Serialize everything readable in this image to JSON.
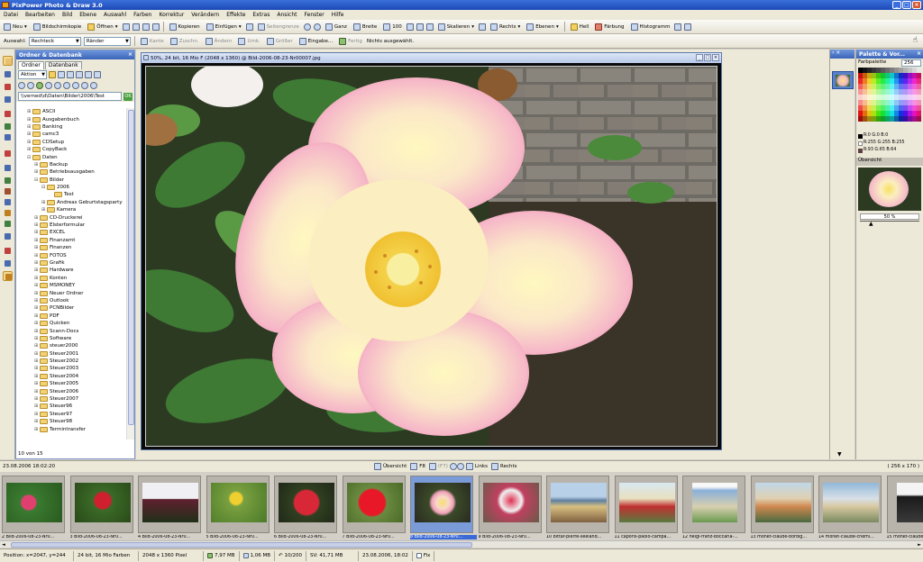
{
  "app": {
    "title": "PixPower Photo & Draw 3.0"
  },
  "menu": [
    "Datei",
    "Bearbeiten",
    "Bild",
    "Ebene",
    "Auswahl",
    "Farben",
    "Korrektur",
    "Verändern",
    "Effekte",
    "Extras",
    "Ansicht",
    "Fenster",
    "Hilfe"
  ],
  "toolbar1": {
    "neu": "Neu",
    "bildschirmkopie": "Bildschirmkopie",
    "oeffnen": "Öffnen",
    "kopieren": "Kopieren",
    "einfuegen": "Einfügen",
    "seitengrenze": "Seitengrenze",
    "ganz": "Ganz",
    "breite": "Breite",
    "zoom": "100",
    "skalieren": "Skalieren",
    "rechts": "Rechts",
    "ebenen": "Ebenen",
    "hell": "Hell",
    "faerbung": "Färbung",
    "histogramm": "Histogramm"
  },
  "toolbar2": {
    "auswahl_label": "Auswahl:",
    "auswahl_value": "Rechteck",
    "raender": "Ränder",
    "kante": "Kante",
    "zuschn": "Zuschn.",
    "aendern": "Ändern",
    "umk": "Umk.",
    "groesser": "Größer",
    "eingabe": "Eingabe...",
    "fertig": "Fertig",
    "status": "Nichts ausgewählt."
  },
  "folder_panel": {
    "title": "Ordner & Datenbank",
    "tabs": [
      "Ordner",
      "Datenbank"
    ],
    "aktion": "Aktion",
    "path": "\\\\verned\\d\\Daten\\Bilder\\2006\\Test",
    "ok": "OK",
    "count": "10 von 15",
    "tree": [
      {
        "label": "ASCII",
        "level": 0,
        "exp": "+"
      },
      {
        "label": "Ausgabenbuch",
        "level": 0,
        "exp": "+"
      },
      {
        "label": "Banking",
        "level": 0,
        "exp": "+"
      },
      {
        "label": "camc3",
        "level": 0,
        "exp": "+"
      },
      {
        "label": "CDSetup",
        "level": 0,
        "exp": "+"
      },
      {
        "label": "CopyBack",
        "level": 0,
        "exp": "+"
      },
      {
        "label": "Daten",
        "level": 0,
        "exp": "-"
      },
      {
        "label": "Backup",
        "level": 1,
        "exp": "+"
      },
      {
        "label": "Betriebsausgaben",
        "level": 1,
        "exp": "+"
      },
      {
        "label": "Bilder",
        "level": 1,
        "exp": "-"
      },
      {
        "label": "2006",
        "level": 2,
        "exp": "-"
      },
      {
        "label": "Test",
        "level": 3,
        "exp": ""
      },
      {
        "label": "Andreas Geburtstagsparty",
        "level": 2,
        "exp": "+"
      },
      {
        "label": "Kamera",
        "level": 2,
        "exp": "+"
      },
      {
        "label": "CD-Druckerei",
        "level": 1,
        "exp": "+"
      },
      {
        "label": "Elsterformular",
        "level": 1,
        "exp": "+"
      },
      {
        "label": "EXCEL",
        "level": 1,
        "exp": "+"
      },
      {
        "label": "Finanzamt",
        "level": 1,
        "exp": "+"
      },
      {
        "label": "Finanzen",
        "level": 1,
        "exp": "+"
      },
      {
        "label": "FOTOS",
        "level": 1,
        "exp": "+"
      },
      {
        "label": "Grafik",
        "level": 1,
        "exp": "+"
      },
      {
        "label": "Hardware",
        "level": 1,
        "exp": "+"
      },
      {
        "label": "Konten",
        "level": 1,
        "exp": "+"
      },
      {
        "label": "MSMONEY",
        "level": 1,
        "exp": "+"
      },
      {
        "label": "Neuer Ordner",
        "level": 1,
        "exp": "+"
      },
      {
        "label": "Outlook",
        "level": 1,
        "exp": "+"
      },
      {
        "label": "PCNBilder",
        "level": 1,
        "exp": "+"
      },
      {
        "label": "PDF",
        "level": 1,
        "exp": "+"
      },
      {
        "label": "Quicken",
        "level": 1,
        "exp": "+"
      },
      {
        "label": "Scann-Docs",
        "level": 1,
        "exp": "+"
      },
      {
        "label": "Software",
        "level": 1,
        "exp": "+"
      },
      {
        "label": "steuer2000",
        "level": 1,
        "exp": "+"
      },
      {
        "label": "Steuer2001",
        "level": 1,
        "exp": "+"
      },
      {
        "label": "Steuer2002",
        "level": 1,
        "exp": "+"
      },
      {
        "label": "Steuer2003",
        "level": 1,
        "exp": "+"
      },
      {
        "label": "Steuer2004",
        "level": 1,
        "exp": "+"
      },
      {
        "label": "Steuer2005",
        "level": 1,
        "exp": "+"
      },
      {
        "label": "Steuer2006",
        "level": 1,
        "exp": "+"
      },
      {
        "label": "Steuer2007",
        "level": 1,
        "exp": "+"
      },
      {
        "label": "Steuer96",
        "level": 1,
        "exp": "+"
      },
      {
        "label": "Steuer97",
        "level": 1,
        "exp": "+"
      },
      {
        "label": "Steuer98",
        "level": 1,
        "exp": "+"
      },
      {
        "label": "Termintransfer",
        "level": 1,
        "exp": "+"
      }
    ]
  },
  "image_window": {
    "title": "50%, 24 bit, 16 Mio F (2048 x 1360) @ Bild-2006-08-23-Nr00007.jpg"
  },
  "right_panel": {
    "title": "Palette & Vor...",
    "farbpalette": "Farbpalette",
    "palette_count": "256",
    "rgb": [
      "R:0   G:0   B:0",
      "R:255 G:255 B:255",
      "R:93  G:65  B:64"
    ],
    "uebersicht": "Übersicht",
    "zoom": "50 %"
  },
  "browser_bar": {
    "date": "23.08.2006 18:02:20",
    "uebersicht": "Übersicht",
    "f8": "F8",
    "f7": "(F7)",
    "links": "Links",
    "rechts": "Rechts",
    "count": "( 256 x 170 )"
  },
  "thumbnails": [
    {
      "num": "2",
      "label": "Bild-2006-08-23-Nr0...",
      "selected": false
    },
    {
      "num": "3",
      "label": "Bild-2006-08-23-Nr0...",
      "selected": false
    },
    {
      "num": "4",
      "label": "Bild-2006-08-23-Nr0...",
      "selected": false
    },
    {
      "num": "5",
      "label": "Bild-2006-08-23-Nr0...",
      "selected": false
    },
    {
      "num": "6",
      "label": "Bild-2006-08-23-Nr0...",
      "selected": false
    },
    {
      "num": "7",
      "label": "Bild-2006-08-23-Nr0...",
      "selected": false
    },
    {
      "num": "8",
      "label": "Bild-2006-08-23-Nr0...",
      "selected": true
    },
    {
      "num": "9",
      "label": "Bild-2006-08-23-Nr0...",
      "selected": false
    },
    {
      "num": "10",
      "label": "bittar-pierre-seeland...",
      "selected": false
    },
    {
      "num": "11",
      "label": "caporis-paolo-campa...",
      "selected": false
    },
    {
      "num": "12",
      "label": "helgi-franz-boccaria-...",
      "selected": false
    },
    {
      "num": "13",
      "label": "monet-claude-bordig...",
      "selected": false
    },
    {
      "num": "14",
      "label": "monet-claude-chemi...",
      "selected": false
    },
    {
      "num": "15",
      "label": "monet-claude-...",
      "selected": false
    }
  ],
  "statusbar": {
    "position": "Position: x=2047, y=244",
    "colors": "24 bit, 16 Mio Farben",
    "size": "2048 x 1360 Pixel",
    "mem1": "7,97 MB",
    "mem2": "1,06 MB",
    "undo": "10/200",
    "sv": "SV:  41,71 MB",
    "datetime": "23.08.2006, 18:02",
    "fix": "Fix"
  },
  "colors": {
    "titlebar": "#1c4ab8",
    "panel_header": "#3a64b8",
    "selected_thumb": "#3a6ad8",
    "folder": "#f3d274"
  }
}
